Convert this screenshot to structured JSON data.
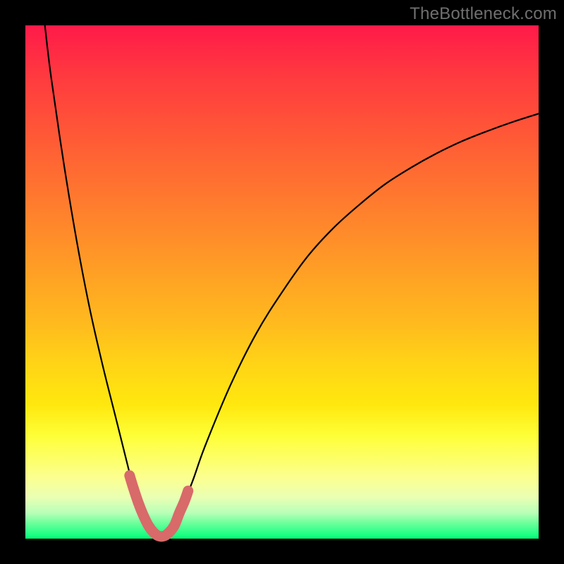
{
  "watermark": "TheBottleneck.com",
  "colors": {
    "background": "#000000",
    "curve": "#000000",
    "segment": "#d86a6a"
  },
  "chart_data": {
    "type": "line",
    "title": "",
    "xlabel": "",
    "ylabel": "",
    "xlim": [
      0,
      100
    ],
    "ylim": [
      0,
      100
    ],
    "grid": false,
    "legend": false,
    "series": [
      {
        "name": "curve",
        "x": [
          3.8,
          5,
          7.5,
          10,
          12.5,
          15,
          17.5,
          20,
          21,
          22,
          23,
          24,
          25,
          26,
          27,
          28,
          29,
          30,
          32.5,
          35,
          40,
          45,
          50,
          55,
          60,
          65,
          70,
          75,
          80,
          85,
          90,
          95,
          100
        ],
        "y": [
          100,
          90,
          73,
          58,
          45,
          34,
          24,
          14,
          10,
          7,
          4.5,
          2.5,
          1.2,
          0.5,
          0.5,
          1.2,
          2.5,
          5,
          11,
          18,
          30,
          40,
          48,
          55,
          60.5,
          65,
          69,
          72.2,
          75,
          77.4,
          79.4,
          81.2,
          82.8
        ]
      },
      {
        "name": "highlight-segment",
        "x": [
          20.3,
          21,
          22,
          23,
          24,
          25,
          26,
          27,
          28,
          29,
          30,
          31,
          31.7
        ],
        "y": [
          12.3,
          10,
          7,
          4.5,
          2.5,
          1.2,
          0.5,
          0.5,
          1.2,
          2.5,
          5,
          7.3,
          9.3
        ]
      }
    ]
  }
}
